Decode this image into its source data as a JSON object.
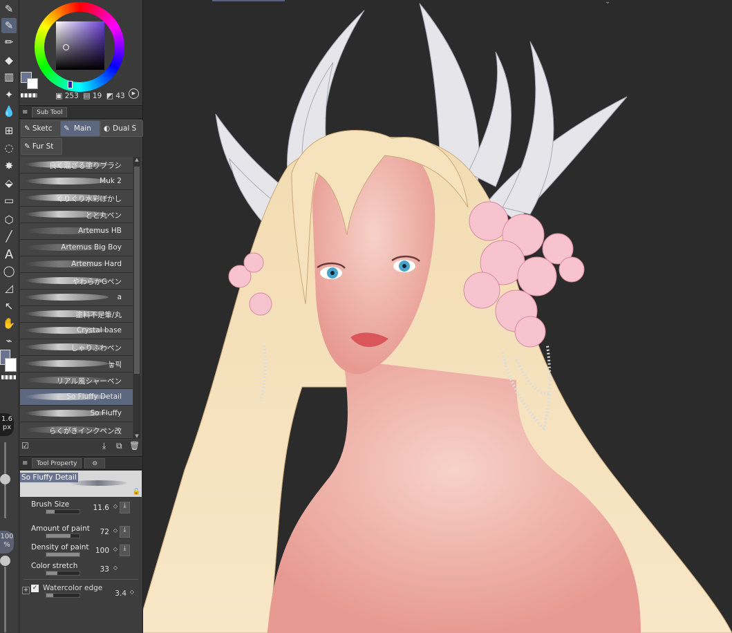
{
  "color": {
    "values": [
      "253",
      "19",
      "43"
    ],
    "picker_hue": "#6a3fd8",
    "main_color": "#6a7390"
  },
  "subtool": {
    "panel_tab": "Sub Tool",
    "groups": [
      "Sketc",
      "Main",
      "Dual S",
      "Fur St"
    ],
    "brushes": [
      {
        "name": "良く混ざる塗りブラシ"
      },
      {
        "name": "Muk 2"
      },
      {
        "name": "ぐりぐり水彩ぼかし"
      },
      {
        "name": "とと丸ペン"
      },
      {
        "name": "Artemus HB"
      },
      {
        "name": "Artemus Big Boy"
      },
      {
        "name": "Artemus Hard"
      },
      {
        "name": "やわらかGペン"
      },
      {
        "name": "a"
      },
      {
        "name": "塗料不足筆/丸"
      },
      {
        "name": "Crystal base"
      },
      {
        "name": "しゃりふわペン"
      },
      {
        "name": "놓픽"
      },
      {
        "name": "リアル風シャーペン"
      },
      {
        "name": "So Fluffy Detail"
      },
      {
        "name": "So Fluffy"
      },
      {
        "name": "らくがきインクペン改"
      }
    ]
  },
  "tool_property": {
    "panel_tab": "Tool Property",
    "brush_name": "So Fluffy Detail",
    "props": [
      {
        "label": "Brush Size",
        "value": "11.6",
        "fill": 0.25
      },
      {
        "label": "Amount of paint",
        "value": "72",
        "fill": 0.72
      },
      {
        "label": "Density of paint",
        "value": "100",
        "fill": 1.0
      },
      {
        "label": "Color stretch",
        "value": "33",
        "fill": 0.33
      }
    ],
    "watercolor_edge": {
      "label": "Watercolor edge",
      "value": "3.4"
    }
  },
  "left_strip": {
    "size_value": "1.6",
    "size_unit": "px",
    "opacity_value": "100",
    "opacity_unit": "%"
  }
}
